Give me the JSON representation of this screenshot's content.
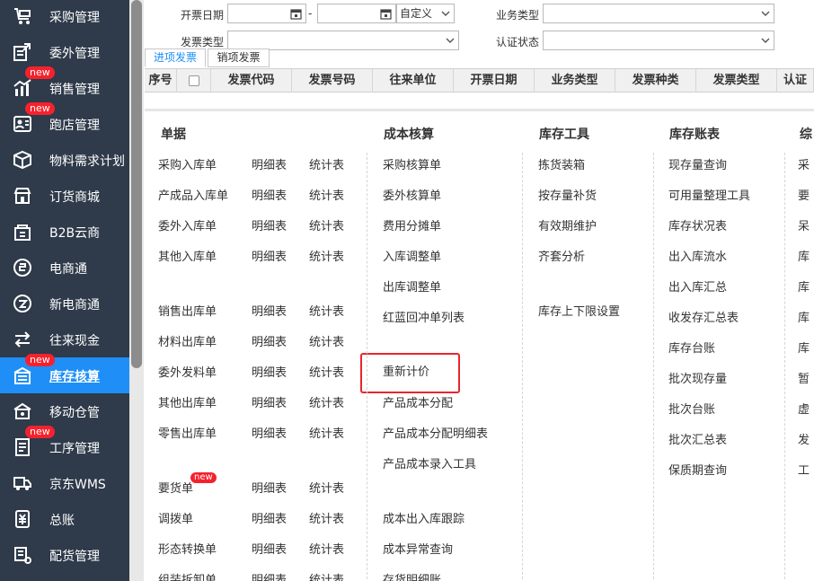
{
  "sidebar": {
    "items": [
      {
        "label": "采购管理",
        "icon": "cart-icon",
        "new": false,
        "active": false
      },
      {
        "label": "委外管理",
        "icon": "outsource-icon",
        "new": false,
        "active": false
      },
      {
        "label": "销售管理",
        "icon": "sales-chart-icon",
        "new": true,
        "active": false
      },
      {
        "label": "跑店管理",
        "icon": "store-visit-icon",
        "new": true,
        "active": false
      },
      {
        "label": "物料需求计划",
        "icon": "package-box-icon",
        "new": false,
        "active": false
      },
      {
        "label": "订货商城",
        "icon": "shop-mall-icon",
        "new": false,
        "active": false
      },
      {
        "label": "B2B云商",
        "icon": "cloud-store-icon",
        "new": false,
        "active": false
      },
      {
        "label": "电商通",
        "icon": "ecommerce-icon",
        "new": false,
        "active": false
      },
      {
        "label": "新电商通",
        "icon": "new-ecommerce-icon",
        "new": false,
        "active": false
      },
      {
        "label": "往来现金",
        "icon": "exchange-arrows-icon",
        "new": false,
        "active": false
      },
      {
        "label": "库存核算",
        "icon": "warehouse-icon",
        "new": true,
        "active": true
      },
      {
        "label": "移动仓管",
        "icon": "mobile-warehouse-icon",
        "new": false,
        "active": false
      },
      {
        "label": "工序管理",
        "icon": "process-doc-icon",
        "new": true,
        "active": false
      },
      {
        "label": "京东WMS",
        "icon": "truck-icon",
        "new": false,
        "active": false
      },
      {
        "label": "总账",
        "icon": "ledger-money-icon",
        "new": false,
        "active": false
      },
      {
        "label": "配货管理",
        "icon": "distribution-icon",
        "new": false,
        "active": false
      }
    ],
    "new_badge": "new"
  },
  "filters": {
    "invoice_date_label": "开票日期",
    "date_from": "",
    "date_sep": "-",
    "date_to": "",
    "date_range_value": "自定义",
    "business_type_label": "业务类型",
    "business_type_value": "",
    "invoice_type_label": "发票类型",
    "invoice_type_value": "",
    "cert_status_label": "认证状态",
    "cert_status_value": ""
  },
  "tabs": [
    {
      "label": "进项发票",
      "active": true
    },
    {
      "label": "销项发票",
      "active": false
    }
  ],
  "table": {
    "columns": [
      "序号",
      "",
      "发票代码",
      "发票号码",
      "往来单位",
      "开票日期",
      "业务类型",
      "发票种类",
      "发票类型",
      "认证"
    ]
  },
  "menu": {
    "columns": [
      {
        "title": "单据"
      },
      {
        "title": "成本核算"
      },
      {
        "title": "库存工具"
      },
      {
        "title": "库存账表"
      },
      {
        "title": "综"
      }
    ],
    "doc_rows": [
      {
        "name": "采购入库单",
        "detail": "明细表",
        "stat": "统计表",
        "new": false
      },
      {
        "name": "产成品入库单",
        "detail": "明细表",
        "stat": "统计表",
        "new": false
      },
      {
        "name": "委外入库单",
        "detail": "明细表",
        "stat": "统计表",
        "new": false
      },
      {
        "name": "其他入库单",
        "detail": "明细表",
        "stat": "统计表",
        "new": false
      },
      {
        "name": "销售出库单",
        "detail": "明细表",
        "stat": "统计表",
        "new": false
      },
      {
        "name": "材料出库单",
        "detail": "明细表",
        "stat": "统计表",
        "new": false
      },
      {
        "name": "委外发料单",
        "detail": "明细表",
        "stat": "统计表",
        "new": false
      },
      {
        "name": "其他出库单",
        "detail": "明细表",
        "stat": "统计表",
        "new": false
      },
      {
        "name": "零售出库单",
        "detail": "明细表",
        "stat": "统计表",
        "new": false
      },
      {
        "name": "要货单",
        "detail": "明细表",
        "stat": "统计表",
        "new": true
      },
      {
        "name": "调拨单",
        "detail": "明细表",
        "stat": "统计表",
        "new": false
      },
      {
        "name": "形态转换单",
        "detail": "明细表",
        "stat": "统计表",
        "new": false
      },
      {
        "name": "组装拆卸单",
        "detail": "明细表",
        "stat": "统计表",
        "new": false
      }
    ],
    "cost_items": [
      "采购核算单",
      "委外核算单",
      "费用分摊单",
      "入库调整单",
      "出库调整单",
      "红蓝回冲单列表",
      "重新计价",
      "产品成本分配",
      "产品成本分配明细表",
      "产品成本录入工具",
      "成本出入库跟踪",
      "成本异常查询",
      "存货明细账"
    ],
    "tool_items": [
      "拣货装箱",
      "按存量补货",
      "有效期维护",
      "齐套分析",
      "库存上下限设置"
    ],
    "report_items": [
      "现存量查询",
      "可用量整理工具",
      "库存状况表",
      "出入库流水",
      "出入库汇总",
      "收发存汇总表",
      "库存台账",
      "批次现存量",
      "批次台账",
      "批次汇总表",
      "保质期查询"
    ],
    "misc_items": [
      "采",
      "要",
      "呆",
      "库",
      "库",
      "库",
      "库",
      "暂",
      "虚",
      "发",
      "工"
    ]
  }
}
